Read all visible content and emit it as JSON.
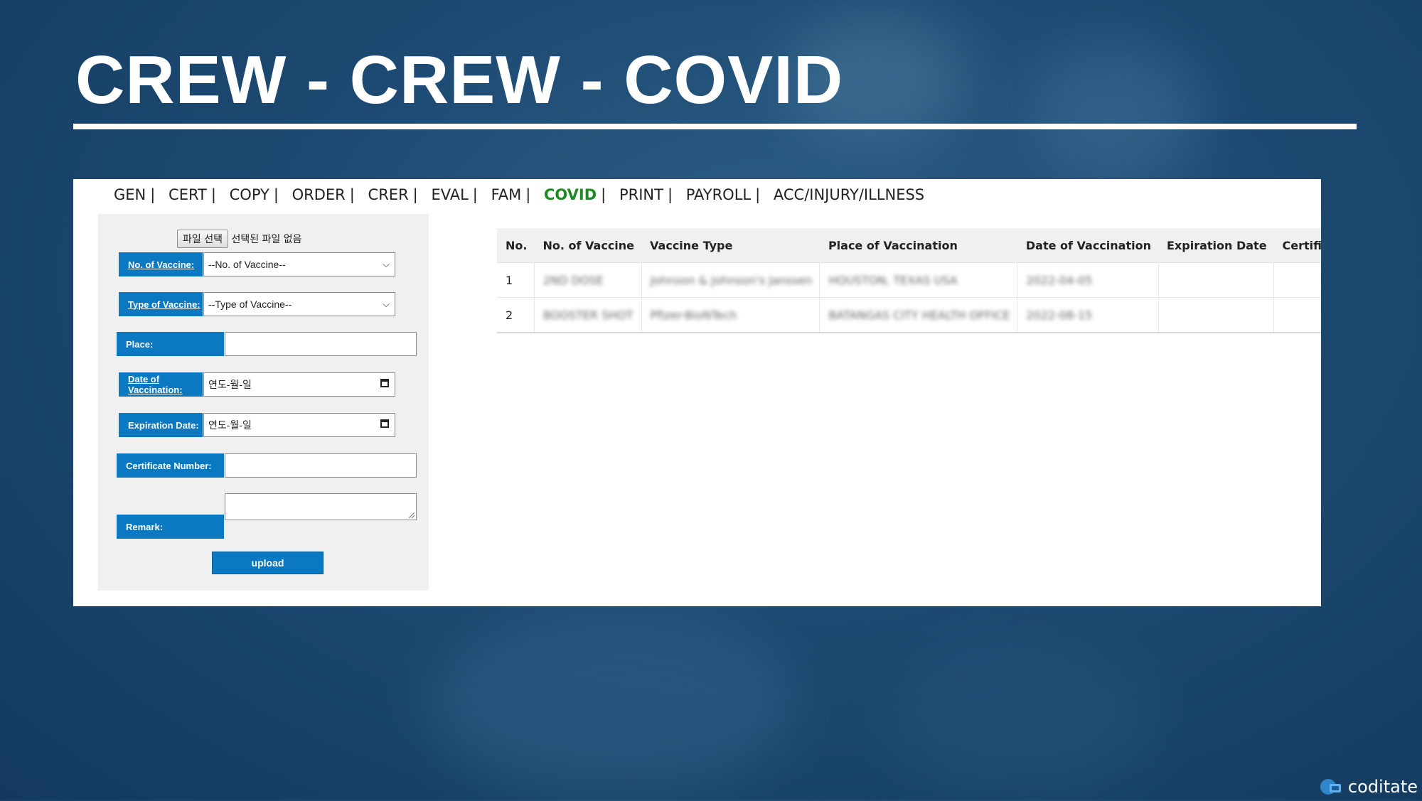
{
  "title": "CREW - CREW - COVID",
  "tabs": [
    "GEN",
    "CERT",
    "COPY",
    "ORDER",
    "CRER",
    "EVAL",
    "FAM",
    "COVID",
    "PRINT",
    "PAYROLL",
    "ACC/INJURY/ILLNESS"
  ],
  "active_tab": "COVID",
  "file_input": {
    "button_label": "파일 선택",
    "status": "선택된 파일 없음"
  },
  "form": {
    "no_of_vaccine_label": "No. of Vaccine:",
    "no_of_vaccine_value": "--No. of Vaccine--",
    "type_of_vaccine_label": "Type of Vaccine:",
    "type_of_vaccine_value": "--Type of Vaccine--",
    "place_label": "Place:",
    "date_label": "Date of Vaccination:",
    "date_placeholder": "연도-월-일",
    "expiration_label": "Expiration Date:",
    "expiration_placeholder": "연도-월-일",
    "certificate_label": "Certificate Number:",
    "remark_label": "Remark:",
    "upload_label": "upload"
  },
  "table": {
    "headers": [
      "No.",
      "No. of Vaccine",
      "Vaccine Type",
      "Place of Vaccination",
      "Date of Vaccination",
      "Expiration Date",
      "Certificate Nu"
    ],
    "rows": [
      [
        "1",
        "2ND DOSE",
        "Johnson & Johnson's Janssen",
        "HOUSTON, TEXAS USA",
        "2022-04-05",
        "",
        ""
      ],
      [
        "2",
        "BOOSTER SHOT",
        "Pfizer-BioNTech",
        "BATANGAS CITY HEALTH OFFICE",
        "2022-08-15",
        "",
        ""
      ]
    ]
  },
  "brand": "coditate",
  "colors": {
    "accent": "#0b78c2",
    "active_tab": "#1f8a24",
    "background": "#1d4a72"
  }
}
